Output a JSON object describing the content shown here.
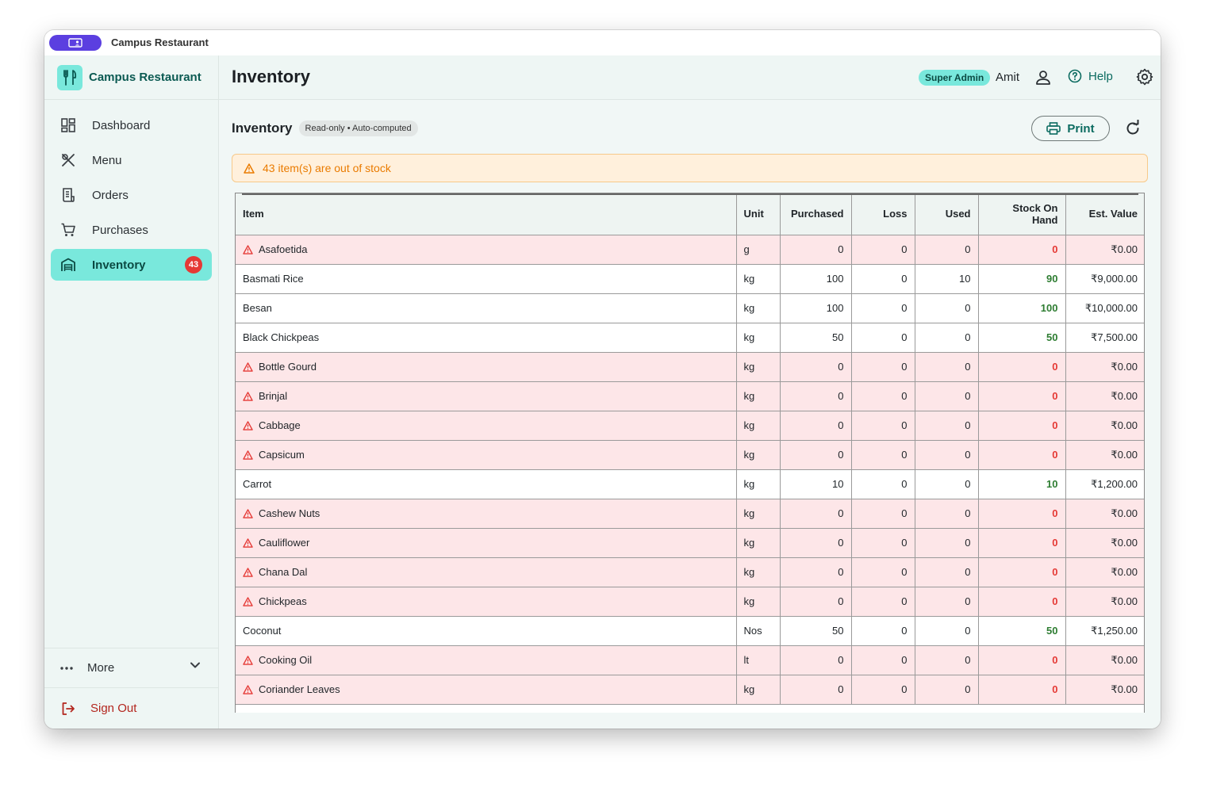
{
  "window": {
    "title": "Campus Restaurant"
  },
  "sidebar": {
    "brand": "Campus Restaurant",
    "items": [
      {
        "label": "Dashboard",
        "icon": "dashboard-icon"
      },
      {
        "label": "Menu",
        "icon": "cutlery-icon"
      },
      {
        "label": "Orders",
        "icon": "receipt-icon"
      },
      {
        "label": "Purchases",
        "icon": "cart-icon"
      },
      {
        "label": "Inventory",
        "icon": "warehouse-icon",
        "badge": "43",
        "active": true
      }
    ],
    "more_label": "More",
    "signout_label": "Sign Out"
  },
  "header": {
    "title": "Inventory",
    "role": "Super Admin",
    "user": "Amit",
    "help": "Help"
  },
  "section": {
    "title": "Inventory",
    "chip": "Read-only • Auto-computed",
    "print_label": "Print"
  },
  "alert": {
    "text": "43 item(s) are out of stock",
    "color": "#ea7b00"
  },
  "colors": {
    "accent": "#79e8dc",
    "brand_text": "#0b5a52",
    "out_of_stock_row": "#fde6e8",
    "out_of_stock_text": "#e53935",
    "in_stock_text": "#2e7d32"
  },
  "table": {
    "headers": {
      "item": "Item",
      "unit": "Unit",
      "purchased": "Purchased",
      "loss": "Loss",
      "used": "Used",
      "stock": "Stock On Hand",
      "value": "Est. Value"
    },
    "rows": [
      {
        "item": "Asafoetida",
        "unit": "g",
        "purchased": "0",
        "loss": "0",
        "used": "0",
        "stock": "0",
        "value": "₹0.00",
        "out": true
      },
      {
        "item": "Basmati Rice",
        "unit": "kg",
        "purchased": "100",
        "loss": "0",
        "used": "10",
        "stock": "90",
        "value": "₹9,000.00",
        "out": false
      },
      {
        "item": "Besan",
        "unit": "kg",
        "purchased": "100",
        "loss": "0",
        "used": "0",
        "stock": "100",
        "value": "₹10,000.00",
        "out": false
      },
      {
        "item": "Black Chickpeas",
        "unit": "kg",
        "purchased": "50",
        "loss": "0",
        "used": "0",
        "stock": "50",
        "value": "₹7,500.00",
        "out": false
      },
      {
        "item": "Bottle Gourd",
        "unit": "kg",
        "purchased": "0",
        "loss": "0",
        "used": "0",
        "stock": "0",
        "value": "₹0.00",
        "out": true
      },
      {
        "item": "Brinjal",
        "unit": "kg",
        "purchased": "0",
        "loss": "0",
        "used": "0",
        "stock": "0",
        "value": "₹0.00",
        "out": true
      },
      {
        "item": "Cabbage",
        "unit": "kg",
        "purchased": "0",
        "loss": "0",
        "used": "0",
        "stock": "0",
        "value": "₹0.00",
        "out": true
      },
      {
        "item": "Capsicum",
        "unit": "kg",
        "purchased": "0",
        "loss": "0",
        "used": "0",
        "stock": "0",
        "value": "₹0.00",
        "out": true
      },
      {
        "item": "Carrot",
        "unit": "kg",
        "purchased": "10",
        "loss": "0",
        "used": "0",
        "stock": "10",
        "value": "₹1,200.00",
        "out": false
      },
      {
        "item": "Cashew Nuts",
        "unit": "kg",
        "purchased": "0",
        "loss": "0",
        "used": "0",
        "stock": "0",
        "value": "₹0.00",
        "out": true
      },
      {
        "item": "Cauliflower",
        "unit": "kg",
        "purchased": "0",
        "loss": "0",
        "used": "0",
        "stock": "0",
        "value": "₹0.00",
        "out": true
      },
      {
        "item": "Chana Dal",
        "unit": "kg",
        "purchased": "0",
        "loss": "0",
        "used": "0",
        "stock": "0",
        "value": "₹0.00",
        "out": true
      },
      {
        "item": "Chickpeas",
        "unit": "kg",
        "purchased": "0",
        "loss": "0",
        "used": "0",
        "stock": "0",
        "value": "₹0.00",
        "out": true
      },
      {
        "item": "Coconut",
        "unit": "Nos",
        "purchased": "50",
        "loss": "0",
        "used": "0",
        "stock": "50",
        "value": "₹1,250.00",
        "out": false
      },
      {
        "item": "Cooking Oil",
        "unit": "lt",
        "purchased": "0",
        "loss": "0",
        "used": "0",
        "stock": "0",
        "value": "₹0.00",
        "out": true
      },
      {
        "item": "Coriander Leaves",
        "unit": "kg",
        "purchased": "0",
        "loss": "0",
        "used": "0",
        "stock": "0",
        "value": "₹0.00",
        "out": true
      }
    ]
  }
}
